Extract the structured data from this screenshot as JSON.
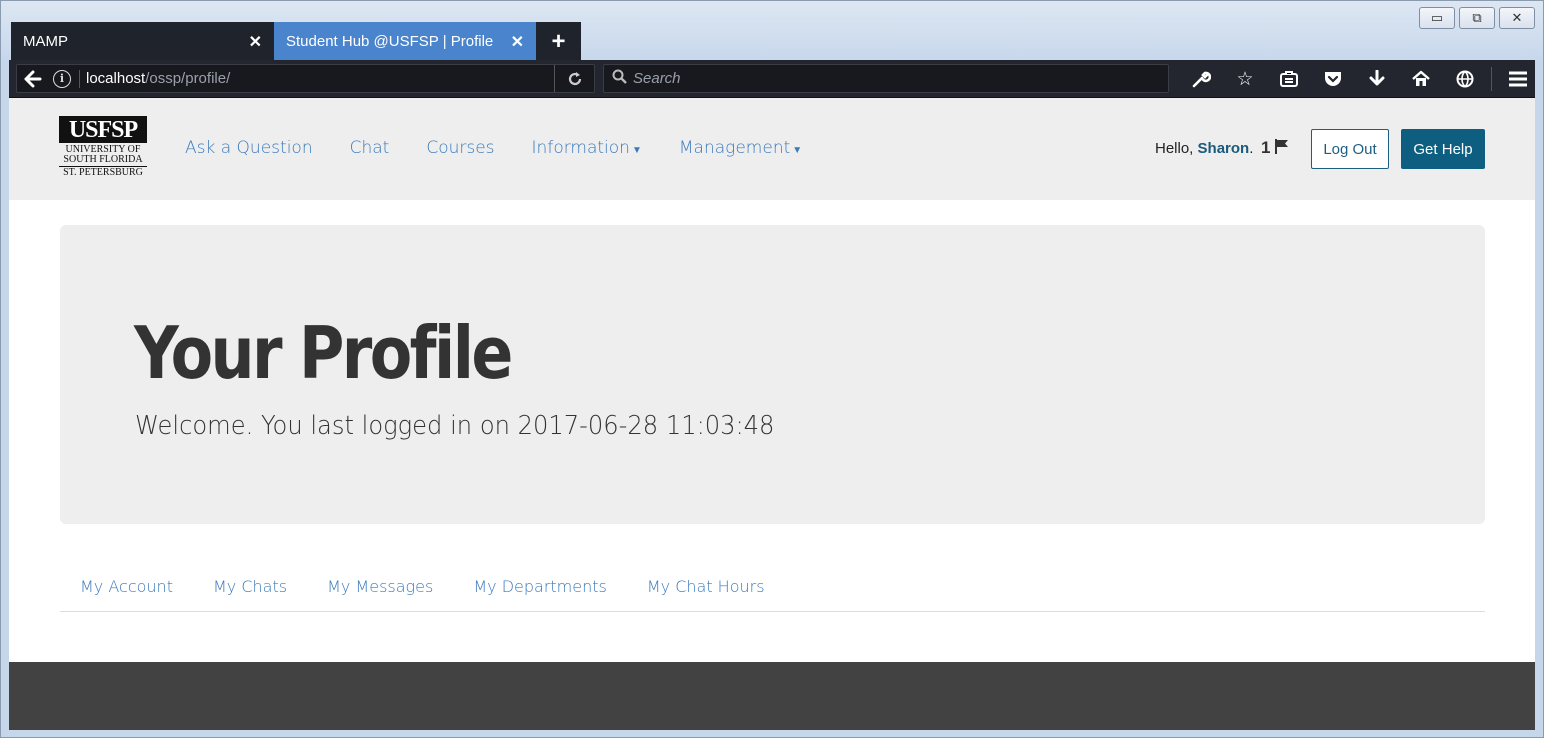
{
  "window": {
    "controls": [
      "minimize",
      "restore",
      "close"
    ]
  },
  "tabs": [
    {
      "label": "MAMP",
      "close": "✕"
    },
    {
      "label": "Student Hub @USFSP | Profile",
      "close": "✕"
    }
  ],
  "new_tab": "+",
  "toolbar": {
    "url_host": "localhost",
    "url_path": "/ossp/profile/",
    "search_placeholder": "Search",
    "icons": [
      "wrench-icon",
      "bookmark-star-icon",
      "reading-list-icon",
      "pocket-icon",
      "download-icon",
      "home-icon",
      "globe-icon",
      "menu-icon"
    ]
  },
  "header": {
    "logo": {
      "wordmark": "USFSP",
      "line1": "UNIVERSITY OF",
      "line2": "SOUTH FLORIDA",
      "line3": "ST. PETERSBURG"
    },
    "nav": [
      {
        "label": "Ask a Question",
        "dropdown": false
      },
      {
        "label": "Chat",
        "dropdown": false
      },
      {
        "label": "Courses",
        "dropdown": false
      },
      {
        "label": "Information",
        "dropdown": true
      },
      {
        "label": "Management",
        "dropdown": true
      }
    ],
    "hello_prefix": "Hello,",
    "user_name": "Sharon",
    "hello_suffix": ".",
    "flag_count": "1",
    "logout_label": "Log Out",
    "get_help_label": "Get Help"
  },
  "jumbotron": {
    "title": "Your Profile",
    "subtitle": "Welcome. You last logged in on 2017-06-28 11:03:48"
  },
  "profile_tabs": [
    "My Account",
    "My Chats",
    "My Messages",
    "My Departments",
    "My Chat Hours"
  ],
  "colors": {
    "link": "#3a7abb",
    "primary": "#0d5e80",
    "header_bg": "#eeeeee",
    "footer_bg": "#424242",
    "active_tab": "#4a84cc"
  }
}
